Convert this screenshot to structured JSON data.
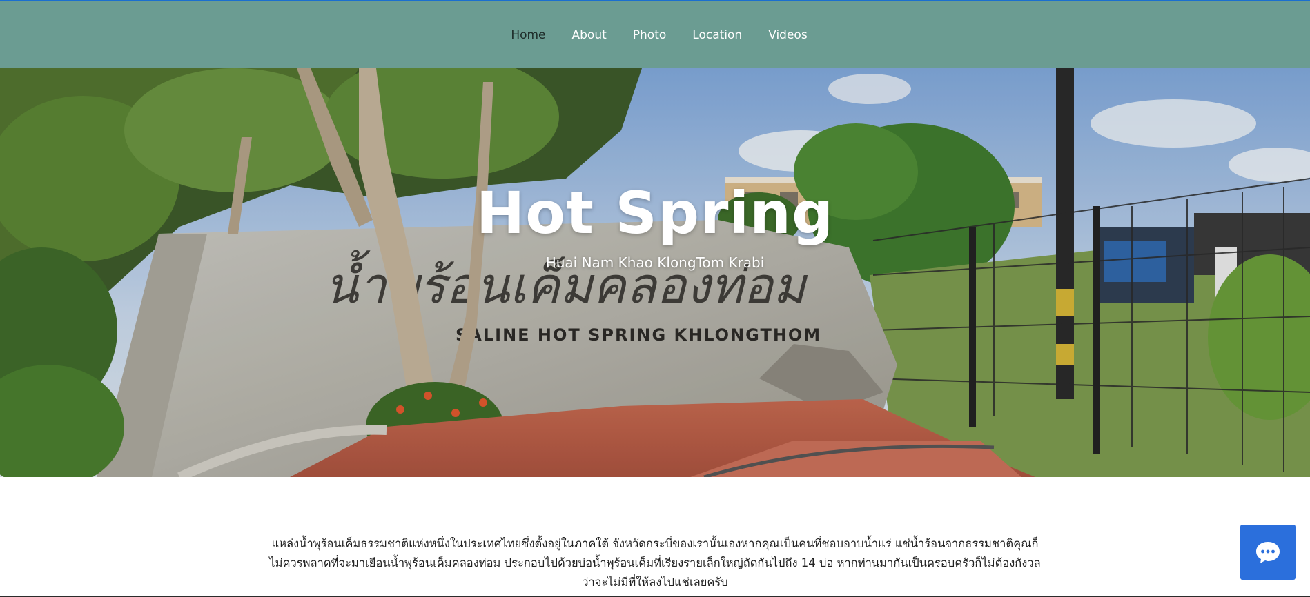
{
  "nav": {
    "items": [
      {
        "label": "Home",
        "active": true
      },
      {
        "label": "About",
        "active": false
      },
      {
        "label": "Photo",
        "active": false
      },
      {
        "label": "Location",
        "active": false
      },
      {
        "label": "Videos",
        "active": false
      }
    ]
  },
  "hero": {
    "title": "Hot Spring",
    "subtitle": "Huai Nam Khao KlongTom Krabi",
    "sign_text_thai": "น้ำพุร้อนเค็มคลองท่อม",
    "sign_text_english": "SALINE HOT SPRING KHLONGTHOM"
  },
  "intro": {
    "text": "แหล่งน้ำพุร้อนเค็มธรรมชาติแห่งหนึ่งในประเทศไทยซึ่งตั้งอยู่ในภาคใต้ จังหวัดกระบี่ของเรานั้นเองหากคุณเป็นคนที่ชอบอาบน้ำแร่ แช่น้ำร้อนจากธรรมชาติคุณก็ไม่ควรพลาดที่จะมาเยือนน้ำพุร้อนเค็มคลองท่อม ประกอบไปด้วยบ่อน้ำพุร้อนเค็มที่เรียงรายเล็กใหญ่ถัดกันไปถึง 14 บ่อ หากท่านมากันเป็นครอบครัวก็ไม่ต้องกังวลว่าจะไม่มีที่ให้ลงไปแช่เลยครับ"
  },
  "chat": {
    "icon": "chat-bubble-icon"
  },
  "colors": {
    "header": "#6b9c92",
    "chat": "#2b6fdc",
    "nav_active": "#1d2b28"
  }
}
